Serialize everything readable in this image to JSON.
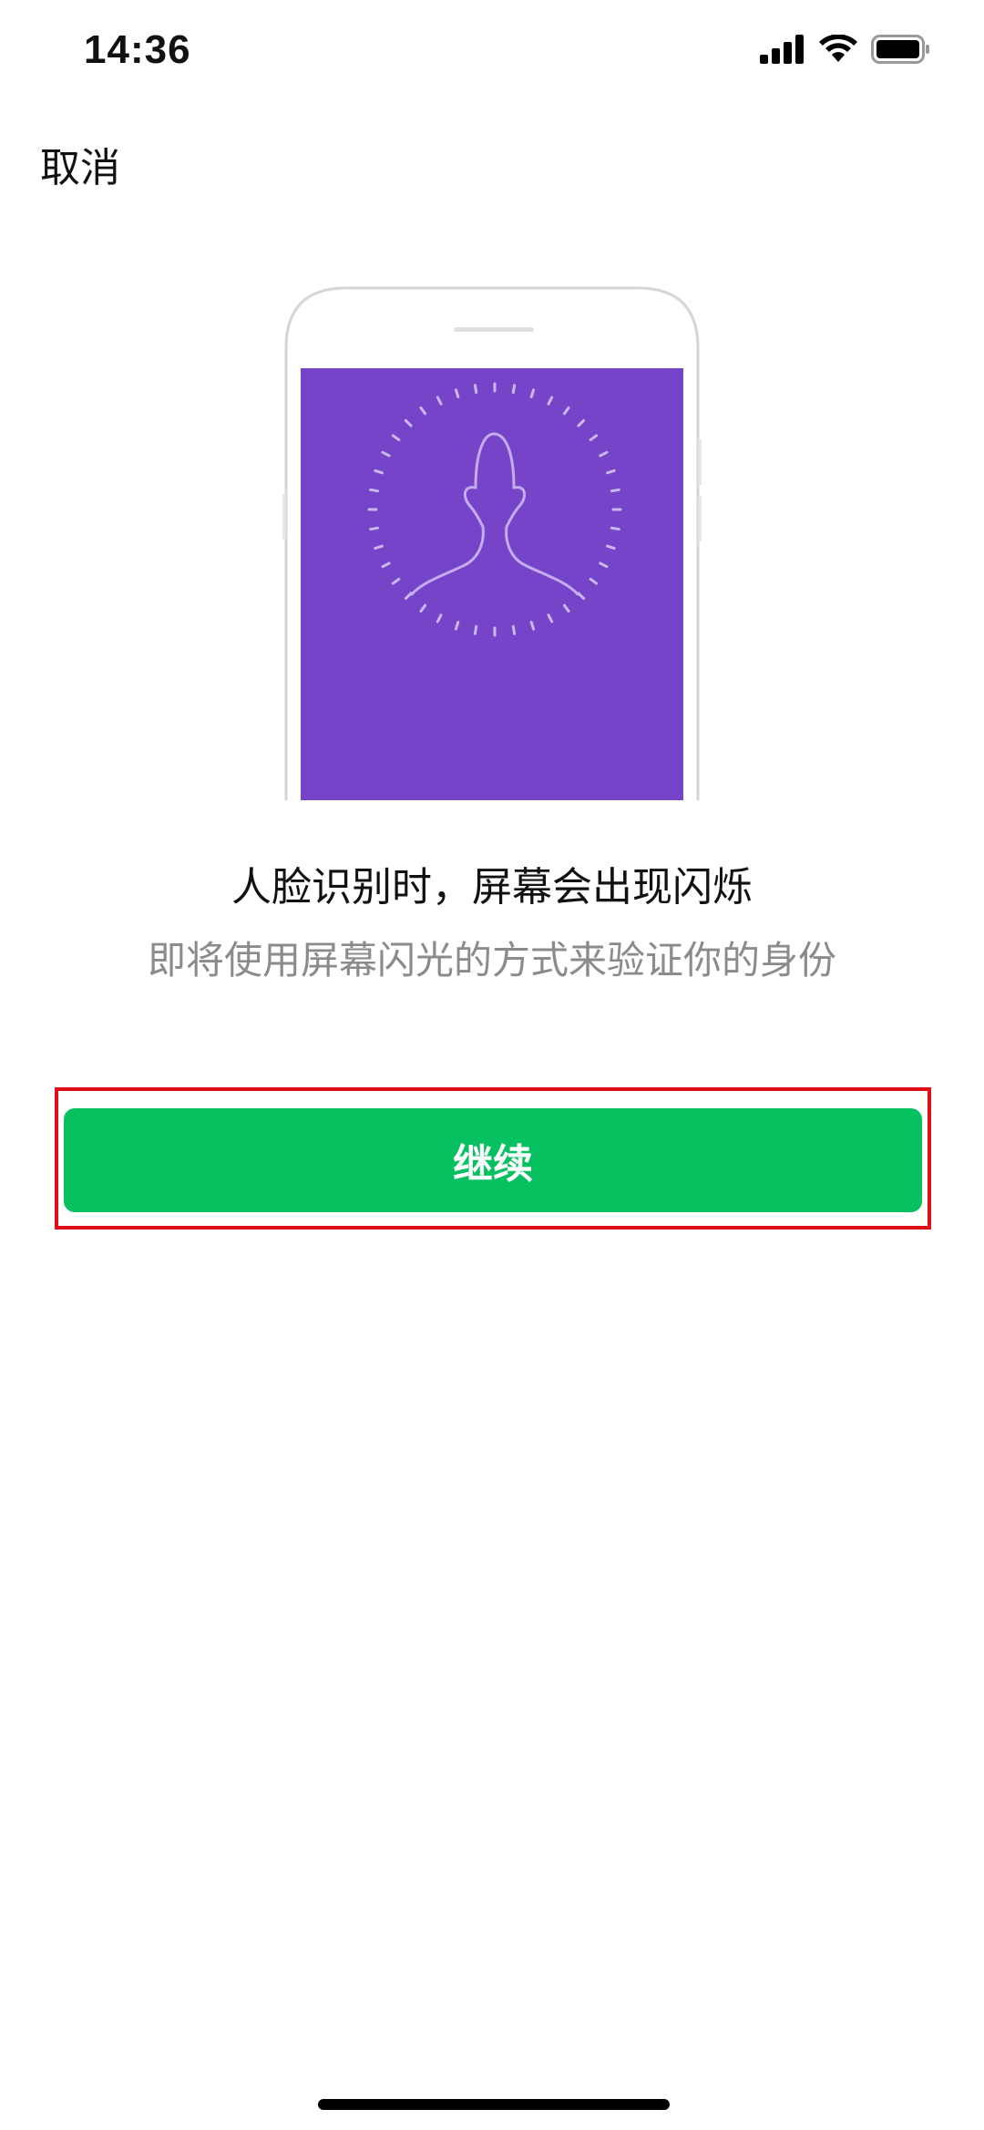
{
  "status_bar": {
    "time": "14:36",
    "icons": [
      "signal-icon",
      "wifi-icon",
      "battery-icon"
    ]
  },
  "nav": {
    "cancel_label": "取消"
  },
  "illustration": {
    "screen_color": "#7544c8",
    "icon": "face-outline-icon"
  },
  "content": {
    "headline": "人脸识别时，屏幕会出现闪烁",
    "subline": "即将使用屏幕闪光的方式来验证你的身份"
  },
  "actions": {
    "continue_label": "继续",
    "continue_color": "#07c160"
  }
}
